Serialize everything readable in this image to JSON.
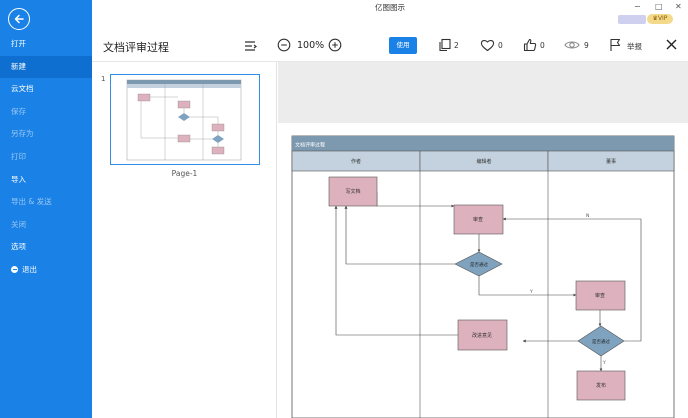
{
  "app": {
    "title": "亿图图示"
  },
  "window": {
    "minimize": "−",
    "maximize": "□",
    "close": "✕"
  },
  "vip": {
    "label": "VIP"
  },
  "sidebar": {
    "items": [
      {
        "label": "打开",
        "disabled": false,
        "active": false
      },
      {
        "label": "新建",
        "disabled": false,
        "active": true
      },
      {
        "label": "云文档",
        "disabled": false,
        "active": false
      },
      {
        "label": "保存",
        "disabled": true,
        "active": false
      },
      {
        "label": "另存为",
        "disabled": true,
        "active": false
      },
      {
        "label": "打印",
        "disabled": true,
        "active": false
      },
      {
        "label": "导入",
        "disabled": false,
        "active": false
      },
      {
        "label": "导出 & 发送",
        "disabled": true,
        "active": false
      },
      {
        "label": "关闭",
        "disabled": true,
        "active": false
      },
      {
        "label": "选项",
        "disabled": false,
        "active": false
      },
      {
        "label": "退出",
        "disabled": false,
        "active": false
      }
    ]
  },
  "toolbar": {
    "doc_title": "文档评审过程",
    "zoom": "100%",
    "use_label": "使用",
    "copies": "2",
    "likes": "0",
    "thumbs": "0",
    "views": "9",
    "report": "举报"
  },
  "pages": {
    "number": "1",
    "label": "Page-1"
  },
  "diagram": {
    "title": "文档评审过程",
    "lanes": [
      "作者",
      "编辑者",
      "董事"
    ],
    "nodes": {
      "write": "写文档",
      "review1": "审查",
      "decision1": "是否通过",
      "review2": "审查",
      "decision2": "是否通过",
      "suggest": "改进意见",
      "publish": "发布"
    },
    "labels": {
      "y": "Y",
      "n": "N"
    },
    "colors": {
      "header": "#7d99b0",
      "lane_header": "#c3d2de",
      "process": "#ddb1bd",
      "decision": "#7fa3bf"
    }
  }
}
